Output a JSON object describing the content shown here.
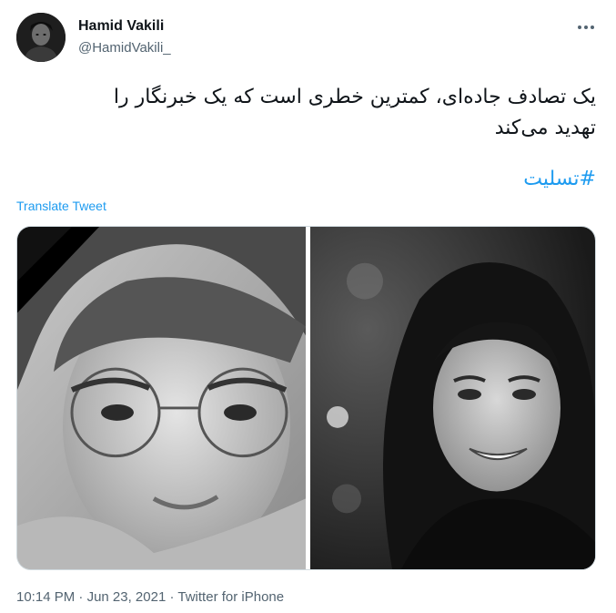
{
  "author": {
    "display_name": "Hamid Vakili",
    "handle": "@HamidVakili_",
    "avatar_icon": "user-avatar-photo"
  },
  "more_icon": "more-horizontal-icon",
  "tweet": {
    "line1": "یک تصادف جاده‌ای، کمترین خطری است که یک خبرنگار را",
    "line2": "تهدید می‌کند",
    "hashtag": "#تسلیت"
  },
  "translate_label": "Translate Tweet",
  "media": {
    "count": 2,
    "left_photo_icon": "portrait-photo-woman-glasses-mourning-ribbon",
    "right_photo_icon": "portrait-photo-woman-headscarf"
  },
  "footer": {
    "time": "10:14 PM",
    "separator": "·",
    "date": "Jun 23, 2021",
    "source": "Twitter for iPhone"
  },
  "colors": {
    "text": "#0f1419",
    "secondary": "#536471",
    "link": "#1d9bf0",
    "border": "#cfd9de"
  }
}
